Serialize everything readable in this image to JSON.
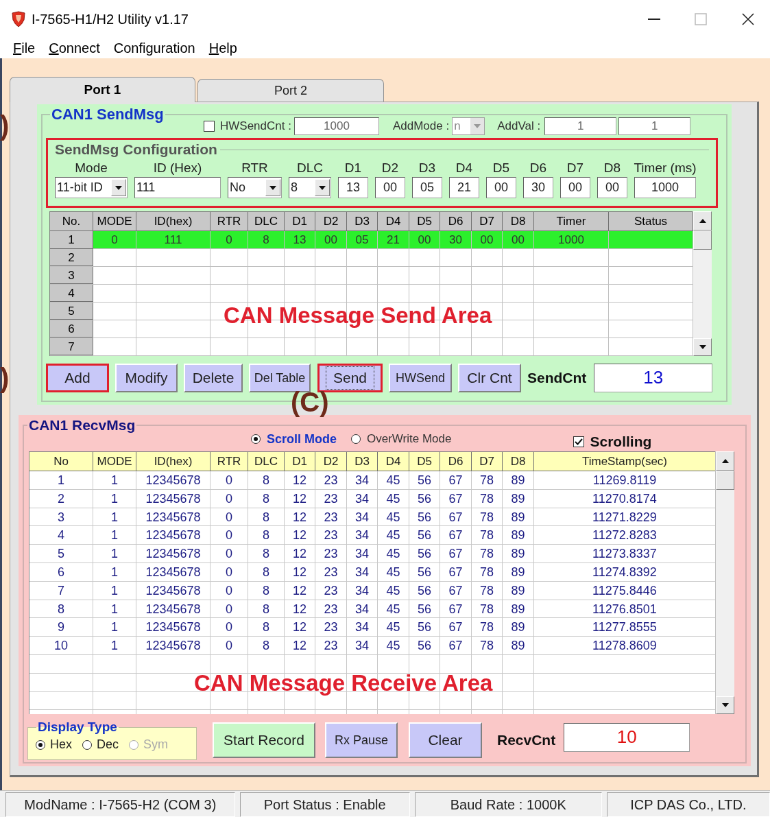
{
  "window": {
    "title": "I-7565-H1/H2 Utility v1.17"
  },
  "menu": [
    {
      "key": "F",
      "rest": "ile"
    },
    {
      "key": "C",
      "rest": "onnect"
    },
    {
      "rest": "Configuration"
    },
    {
      "key": "H",
      "rest": "elp"
    }
  ],
  "tabs": [
    {
      "label": "Port 1",
      "selected": true
    },
    {
      "label": "Port 2",
      "selected": false
    }
  ],
  "send_group": {
    "title": "CAN1 SendMsg",
    "hw_send_cnt": {
      "label": "HWSendCnt :",
      "checked": false,
      "value": "1000"
    },
    "add_mode": {
      "label": "AddMode :",
      "value": "n"
    },
    "add_val": {
      "label": "AddVal :",
      "values": [
        "1",
        "1"
      ]
    },
    "config": {
      "title": "SendMsg Configuration",
      "highlighted": true,
      "fields": [
        {
          "label": "Mode",
          "kind": "dropdown",
          "value": "11-bit ID"
        },
        {
          "label": "ID (Hex)",
          "kind": "text",
          "value": "111"
        },
        {
          "label": "RTR",
          "kind": "dropdown",
          "value": "No"
        },
        {
          "label": "DLC",
          "kind": "dropdown",
          "value": "8"
        },
        {
          "label": "D1",
          "kind": "text",
          "value": "13"
        },
        {
          "label": "D2",
          "kind": "text",
          "value": "00"
        },
        {
          "label": "D3",
          "kind": "text",
          "value": "05"
        },
        {
          "label": "D4",
          "kind": "text",
          "value": "21"
        },
        {
          "label": "D5",
          "kind": "text",
          "value": "00"
        },
        {
          "label": "D6",
          "kind": "text",
          "value": "30"
        },
        {
          "label": "D7",
          "kind": "text",
          "value": "00"
        },
        {
          "label": "D8",
          "kind": "text",
          "value": "00"
        },
        {
          "label": "Timer (ms)",
          "kind": "text",
          "value": "1000"
        }
      ]
    },
    "table": {
      "columns": [
        "No.",
        "MODE",
        "ID(hex)",
        "RTR",
        "DLC",
        "D1",
        "D2",
        "D3",
        "D4",
        "D5",
        "D6",
        "D7",
        "D8",
        "Timer",
        "Status"
      ],
      "rows": [
        {
          "no": "1",
          "selected": true,
          "cells": [
            "0",
            "111",
            "0",
            "8",
            "13",
            "00",
            "05",
            "21",
            "00",
            "30",
            "00",
            "00",
            "1000"
          ]
        },
        {
          "no": "2",
          "selected": false
        },
        {
          "no": "3",
          "selected": false
        },
        {
          "no": "4",
          "selected": false
        },
        {
          "no": "5",
          "selected": false
        },
        {
          "no": "6",
          "selected": false
        },
        {
          "no": "7",
          "selected": false
        }
      ],
      "overlay_label": "CAN Message Send Area"
    },
    "buttons": [
      {
        "label": "Add",
        "highlighted": true,
        "focused": false
      },
      {
        "label": "Modify",
        "highlighted": false,
        "focused": false
      },
      {
        "label": "Delete",
        "highlighted": false,
        "focused": false
      },
      {
        "label": "Del Table",
        "highlighted": false,
        "focused": false
      },
      {
        "label": "Send",
        "highlighted": true,
        "focused": true
      },
      {
        "label": "HWSend",
        "highlighted": false,
        "focused": false
      },
      {
        "label": "Clr Cnt",
        "highlighted": false,
        "focused": false
      }
    ],
    "send_cnt": {
      "label": "SendCnt",
      "value": "13"
    }
  },
  "recv_group": {
    "title": "CAN1 RecvMsg",
    "modes": [
      {
        "label": "Scroll Mode",
        "selected": true
      },
      {
        "label": "OverWrite Mode",
        "selected": false
      }
    ],
    "scrolling": {
      "label": "Scrolling",
      "checked": true
    },
    "table": {
      "columns": [
        "No",
        "MODE",
        "ID(hex)",
        "RTR",
        "DLC",
        "D1",
        "D2",
        "D3",
        "D4",
        "D5",
        "D6",
        "D7",
        "D8",
        "TimeStamp(sec)"
      ],
      "rows": [
        [
          "1",
          "1",
          "12345678",
          "0",
          "8",
          "12",
          "23",
          "34",
          "45",
          "56",
          "67",
          "78",
          "89",
          "11269.8119"
        ],
        [
          "2",
          "1",
          "12345678",
          "0",
          "8",
          "12",
          "23",
          "34",
          "45",
          "56",
          "67",
          "78",
          "89",
          "11270.8174"
        ],
        [
          "3",
          "1",
          "12345678",
          "0",
          "8",
          "12",
          "23",
          "34",
          "45",
          "56",
          "67",
          "78",
          "89",
          "11271.8229"
        ],
        [
          "4",
          "1",
          "12345678",
          "0",
          "8",
          "12",
          "23",
          "34",
          "45",
          "56",
          "67",
          "78",
          "89",
          "11272.8283"
        ],
        [
          "5",
          "1",
          "12345678",
          "0",
          "8",
          "12",
          "23",
          "34",
          "45",
          "56",
          "67",
          "78",
          "89",
          "11273.8337"
        ],
        [
          "6",
          "1",
          "12345678",
          "0",
          "8",
          "12",
          "23",
          "34",
          "45",
          "56",
          "67",
          "78",
          "89",
          "11274.8392"
        ],
        [
          "7",
          "1",
          "12345678",
          "0",
          "8",
          "12",
          "23",
          "34",
          "45",
          "56",
          "67",
          "78",
          "89",
          "11275.8446"
        ],
        [
          "8",
          "1",
          "12345678",
          "0",
          "8",
          "12",
          "23",
          "34",
          "45",
          "56",
          "67",
          "78",
          "89",
          "11276.8501"
        ],
        [
          "9",
          "1",
          "12345678",
          "0",
          "8",
          "12",
          "23",
          "34",
          "45",
          "56",
          "67",
          "78",
          "89",
          "11277.8555"
        ],
        [
          "10",
          "1",
          "12345678",
          "0",
          "8",
          "12",
          "23",
          "34",
          "45",
          "56",
          "67",
          "78",
          "89",
          "11278.8609"
        ]
      ],
      "overlay_label": "CAN Message Receive Area"
    },
    "display_type": {
      "title": "Display Type",
      "options": [
        {
          "label": "Hex",
          "selected": true,
          "disabled": false
        },
        {
          "label": "Dec",
          "selected": false,
          "disabled": false
        },
        {
          "label": "Sym",
          "selected": false,
          "disabled": true
        }
      ]
    },
    "buttons": [
      {
        "label": "Start Record",
        "color": "#c8f8c8"
      },
      {
        "label": "Rx Pause",
        "color": "#c8c8f8"
      },
      {
        "label": "Clear",
        "color": "#c8c8f8"
      }
    ],
    "recv_cnt": {
      "label": "RecvCnt",
      "value": "10"
    }
  },
  "status_bar": [
    "ModName : I-7565-H2 (COM 3)",
    "Port Status : Enable",
    "Baud Rate : 1000K",
    "ICP DAS Co., LTD."
  ],
  "annotations": [
    ")",
    ")",
    "(C)"
  ]
}
